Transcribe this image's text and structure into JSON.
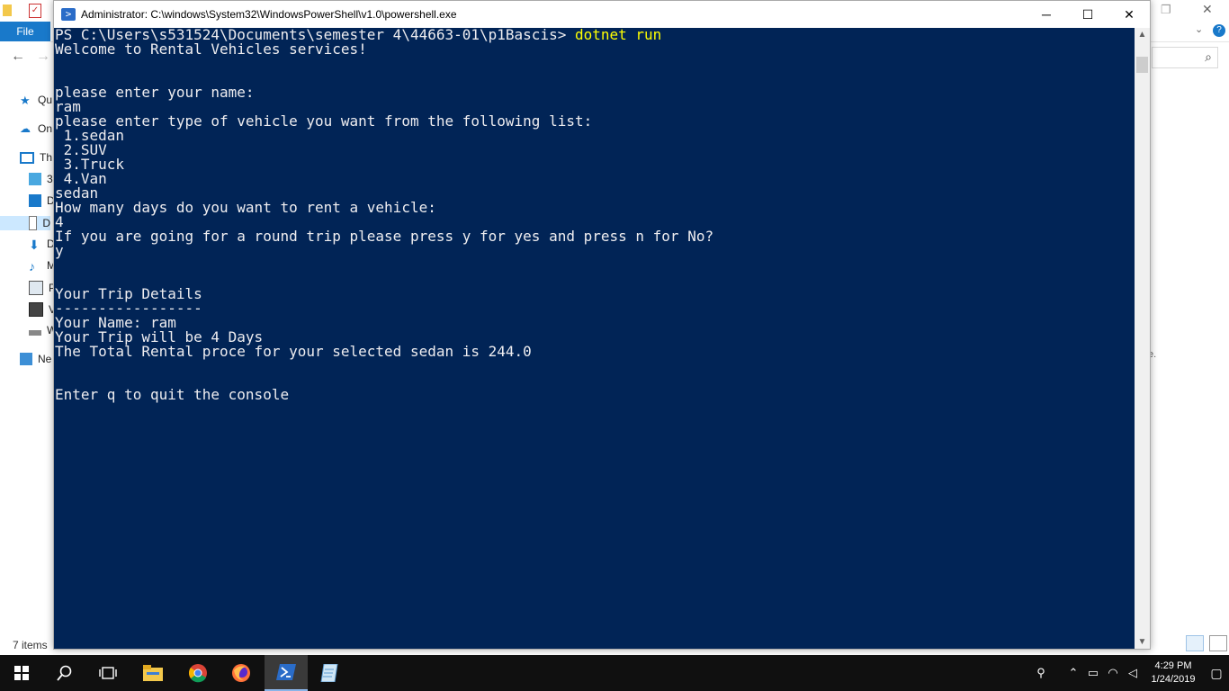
{
  "explorer": {
    "file_tab": "File",
    "sidebar": [
      {
        "label": "Qu",
        "icon": "star-icon"
      },
      {
        "label": "On",
        "icon": "cloud-icon"
      },
      {
        "label": "Th",
        "icon": "computer-icon"
      },
      {
        "label": "3",
        "icon": "cube-icon"
      },
      {
        "label": "D",
        "icon": "desktop-icon"
      },
      {
        "label": "D",
        "icon": "document-icon"
      },
      {
        "label": "D",
        "icon": "download-icon"
      },
      {
        "label": "M",
        "icon": "music-icon"
      },
      {
        "label": "P",
        "icon": "picture-icon"
      },
      {
        "label": "V",
        "icon": "video-icon"
      },
      {
        "label": "W",
        "icon": "drive-icon"
      },
      {
        "label": "Ne",
        "icon": "network-icon"
      }
    ],
    "status": "7 items",
    "right_text": "e."
  },
  "powershell": {
    "title": "Administrator: C:\\windows\\System32\\WindowsPowerShell\\v1.0\\powershell.exe",
    "prompt": "PS C:\\Users\\s531524\\Documents\\semester 4\\44663-01\\p1Bascis> ",
    "command": "dotnet run",
    "lines": [
      "Welcome to Rental Vehicles services!",
      "",
      "",
      "please enter your name:",
      "ram",
      "please enter type of vehicle you want from the following list:",
      " 1.sedan",
      " 2.SUV",
      " 3.Truck",
      " 4.Van",
      "sedan",
      "How many days do you want to rent a vehicle:",
      "4",
      "If you are going for a round trip please press y for yes and press n for No?",
      "y",
      "",
      "",
      "Your Trip Details",
      "-----------------",
      "Your Name: ram",
      "Your Trip will be 4 Days",
      "The Total Rental proce for your selected sedan is 244.0",
      "",
      "",
      "Enter q to quit the console"
    ],
    "colors": {
      "background": "#012456",
      "text": "#eeedf0",
      "command": "#ffff00"
    }
  },
  "taskbar": {
    "time": "4:29 PM",
    "date": "1/24/2019"
  }
}
